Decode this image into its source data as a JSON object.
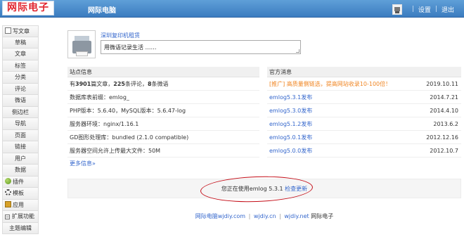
{
  "header": {
    "logo": "网际电子",
    "site_name": "网际电脑",
    "settings": "设置",
    "logout": "退出",
    "separator": "|",
    "bg_color": "#3b7cc0"
  },
  "sidebar": {
    "items": [
      {
        "label": "写文章",
        "icon": "write-icon"
      },
      {
        "label": "草稿"
      },
      {
        "label": "文章"
      },
      {
        "label": "标签"
      },
      {
        "label": "分类"
      },
      {
        "label": "评论"
      },
      {
        "label": "微语"
      },
      {
        "label": "侧边栏"
      },
      {
        "label": "导航"
      },
      {
        "label": "页面"
      },
      {
        "label": "链接"
      },
      {
        "label": "用户"
      },
      {
        "label": "数据"
      },
      {
        "label": "插件",
        "icon": "plugin-icon"
      },
      {
        "label": "模板",
        "icon": "template-icon"
      },
      {
        "label": "应用",
        "icon": "app-icon"
      },
      {
        "label": "扩展功能",
        "icon": "collapse-icon",
        "symbol": "−"
      },
      {
        "label": "主题编辑"
      }
    ]
  },
  "twitter": {
    "link": "深圳复印机租赁",
    "input_value": "用微语记录生活 ……"
  },
  "site_info": {
    "title": "站点信息",
    "stats": {
      "pre": "有",
      "articles": "3901",
      "mid1": "篇文章，",
      "comments": "225",
      "mid2": "条评论，",
      "twitters": "8",
      "post": "条微语"
    },
    "rows": [
      "数据库表前缀：emlog_",
      "PHP版本：5.6.40，MySQL版本：5.6.47-log",
      "服务器环境：nginx/1.16.1",
      "GD图形处理库：bundled (2.1.0 compatible)",
      "服务器空间允许上传最大文件：50M"
    ],
    "more": "更多信息»"
  },
  "official_news": {
    "title": "官方消息",
    "items": [
      {
        "text": "[推广] 高质量側链选，提高网站收录10-100倍！",
        "date": "2019.10.11"
      },
      {
        "text": "emlog5.3.1发布",
        "date": "2014.7.21"
      },
      {
        "text": "emlog5.3.0发布",
        "date": "2014.4.10"
      },
      {
        "text": "emlog5.1.2发布",
        "date": "2013.6.2"
      },
      {
        "text": "emlog5.0.1发布",
        "date": "2012.12.16"
      },
      {
        "text": "emlog5.0.0发布",
        "date": "2012.10.7"
      }
    ]
  },
  "version": {
    "text": "您正在使用emlog 5.3.1",
    "check": "检查更新"
  },
  "footer": {
    "link1": "网际电脑wjdiy.com",
    "link2": "wjdiy.cn",
    "link3": "wjdiy.net",
    "tail": "网际电子",
    "sep": "|"
  }
}
